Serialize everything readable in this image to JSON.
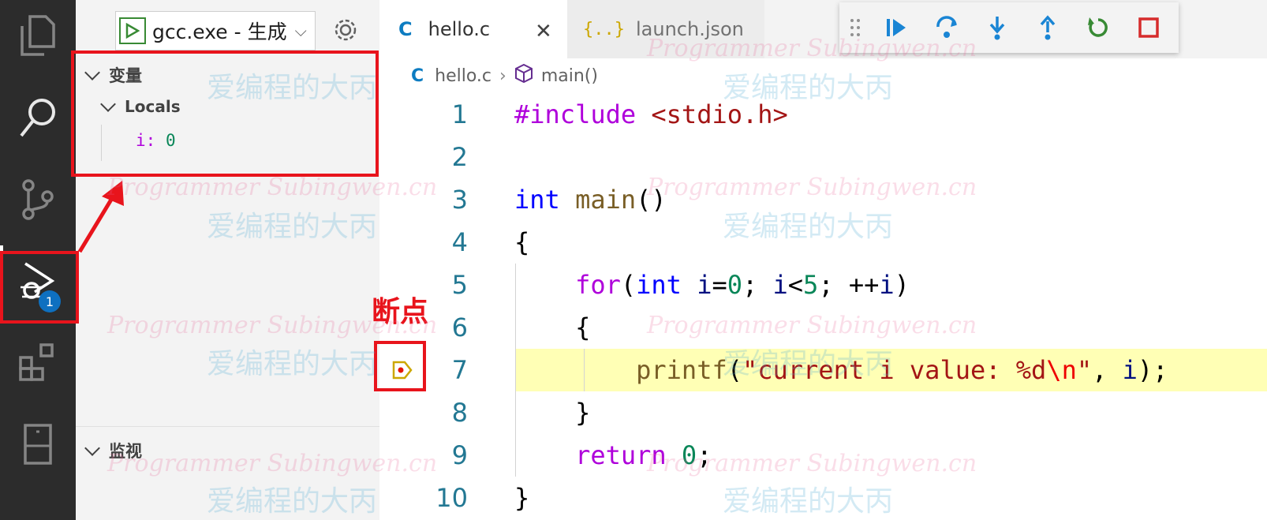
{
  "debug": {
    "configuration": "gcc.exe - 生成",
    "variables_title": "变量",
    "locals_title": "Locals",
    "var_name": "i:",
    "var_value": "0",
    "watch_title": "监视",
    "badge": "1"
  },
  "tabs": [
    {
      "icon": "C",
      "label": "hello.c"
    },
    {
      "icon": "{..}",
      "label": "launch.json"
    }
  ],
  "breadcrumb": {
    "file": "hello.c",
    "symbol": "main()"
  },
  "annotation": {
    "label": "断点"
  },
  "code": {
    "line_numbers": [
      "1",
      "2",
      "3",
      "4",
      "5",
      "6",
      "7",
      "8",
      "9",
      "10"
    ]
  },
  "watermark": {
    "en": "Programmer Subingwen.cn",
    "cn": "爱编程的大丙"
  },
  "colors": {
    "accent": "#0e70c0",
    "annotation": "#e8141c",
    "highlight": "#ffff9c"
  }
}
